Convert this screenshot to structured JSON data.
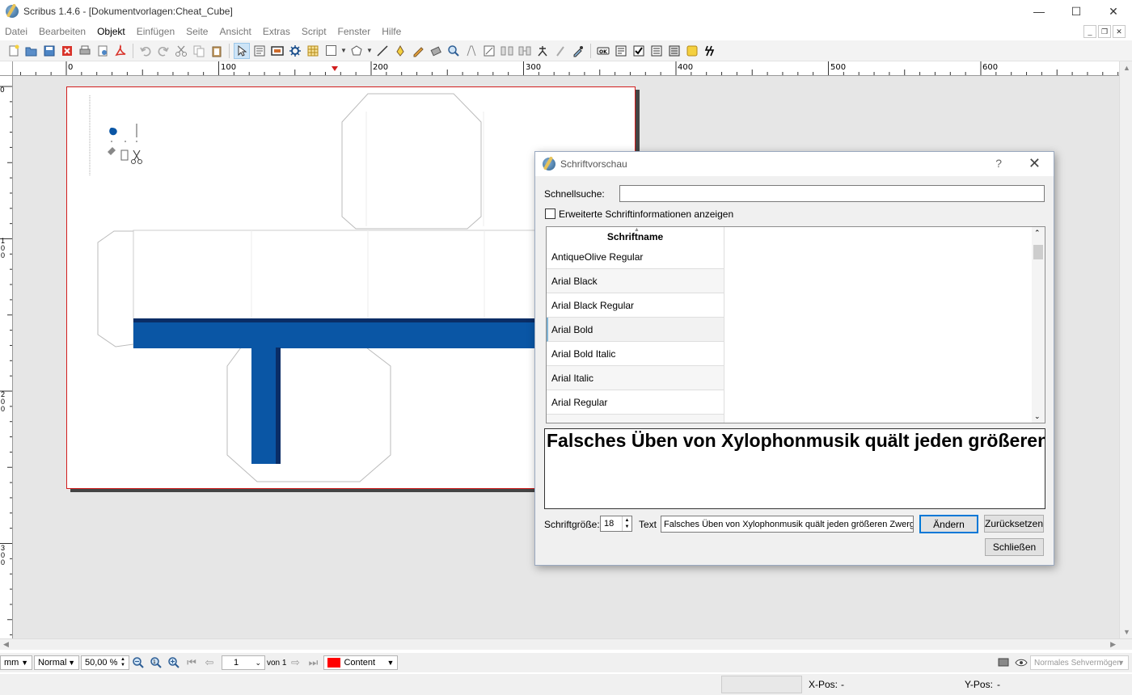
{
  "window": {
    "title": "Scribus 1.4.6 - [Dokumentvorlagen:Cheat_Cube]",
    "minimize_glyph": "—",
    "maximize_glyph": "☐",
    "close_glyph": "✕"
  },
  "menu": {
    "items": [
      "Datei",
      "Bearbeiten",
      "Objekt",
      "Einfügen",
      "Seite",
      "Ansicht",
      "Extras",
      "Script",
      "Fenster",
      "Hilfe"
    ],
    "active_index": 2,
    "mdi": [
      "_",
      "❐",
      "✕"
    ]
  },
  "toolbar": {
    "icons": [
      "new-document-icon",
      "open-icon",
      "save-icon",
      "close-document-icon",
      "print-icon",
      "preflight-icon",
      "export-pdf-icon",
      "undo-icon",
      "redo-icon",
      "cut-icon",
      "copy-icon",
      "paste-icon",
      "select-icon",
      "text-frame-icon",
      "image-frame-icon",
      "render-frame-icon",
      "table-icon",
      "shape-icon",
      "polygon-icon",
      "line-icon",
      "bezier-icon",
      "freehand-icon",
      "rotate-icon",
      "zoom-icon",
      "edit-text-icon",
      "story-editor-icon",
      "link-frames-icon",
      "unlink-frames-icon",
      "measure-icon",
      "copy-properties-icon",
      "eyedropper-icon",
      "pdf-button-icon",
      "pdf-textfield-icon",
      "pdf-checkbox-icon",
      "pdf-combobox-icon",
      "pdf-listbox-icon",
      "pdf-annotation-icon",
      "pdf-link-icon"
    ]
  },
  "ruler": {
    "h_labels": [
      "0",
      "100",
      "200",
      "300",
      "400",
      "500",
      "600"
    ],
    "v_labels": [
      "0",
      "1\n0\n0",
      "2\n0\n0",
      "3\n0\n0"
    ]
  },
  "dialog": {
    "title": "Schriftvorschau",
    "help_glyph": "?",
    "close_glyph": "✕",
    "search_label": "Schnellsuche:",
    "search_value": "",
    "extended_info_label": "Erweiterte Schriftinformationen anzeigen",
    "list_header": "Schriftname",
    "fonts": [
      "AntiqueOlive Regular",
      "Arial Black",
      "Arial Black Regular",
      "Arial Bold",
      "Arial Bold Italic",
      "Arial Italic",
      "Arial Regular"
    ],
    "selected_font_index": 3,
    "preview_text": "Falsches Üben von Xylophonmusik quält jeden größeren Zwerg",
    "size_label": "Schriftgröße:",
    "size_value": "18",
    "text_label": "Text",
    "text_value": "Falsches Üben von Xylophonmusik quält jeden größeren Zwerg",
    "change_button": "Ändern",
    "reset_button": "Zurücksetzen",
    "close_button": "Schließen"
  },
  "bottombar": {
    "unit": "mm",
    "mode": "Normal",
    "zoom": "50,00 %",
    "page": "1",
    "of_pages": "von 1",
    "layer": "Content",
    "layer_color": "#ff0000",
    "vision": "Normales Sehvermögen"
  },
  "status": {
    "xpos_label": "X-Pos:",
    "xpos_value": "-",
    "ypos_label": "Y-Pos:",
    "ypos_value": "-"
  },
  "colors": {
    "accent_blue": "#0a56a5",
    "page_border": "#d21d1d"
  }
}
